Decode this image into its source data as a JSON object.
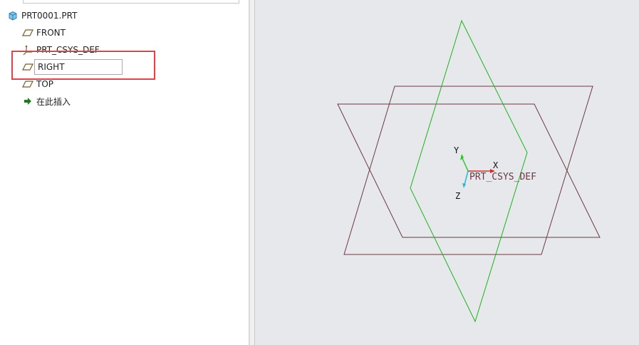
{
  "model_tree": {
    "part_name": "PRT0001.PRT",
    "items": [
      {
        "label": "FRONT",
        "icon": "datum-plane-icon"
      },
      {
        "label": "PRT_CSYS_DEF",
        "icon": "coordinate-system-icon"
      },
      {
        "label": "RIGHT",
        "icon": "datum-plane-icon",
        "editing": true
      },
      {
        "label": "TOP",
        "icon": "datum-plane-icon"
      },
      {
        "label": "在此插入",
        "icon": "insert-here-arrow-icon"
      }
    ],
    "rename_value": "RIGHT"
  },
  "graphics": {
    "csys_label": "PRT_CSYS_DEF",
    "axis_x": "X",
    "axis_y": "Y",
    "axis_z": "Z",
    "colors": {
      "datum_plane_front_top": "#6b3a44",
      "datum_plane_right": "#19b519",
      "axis_x": "#d03030",
      "axis_y": "#2cc62c",
      "axis_z": "#29b6d8",
      "highlight": "#e0424a",
      "background": "#e7e8eb"
    }
  }
}
